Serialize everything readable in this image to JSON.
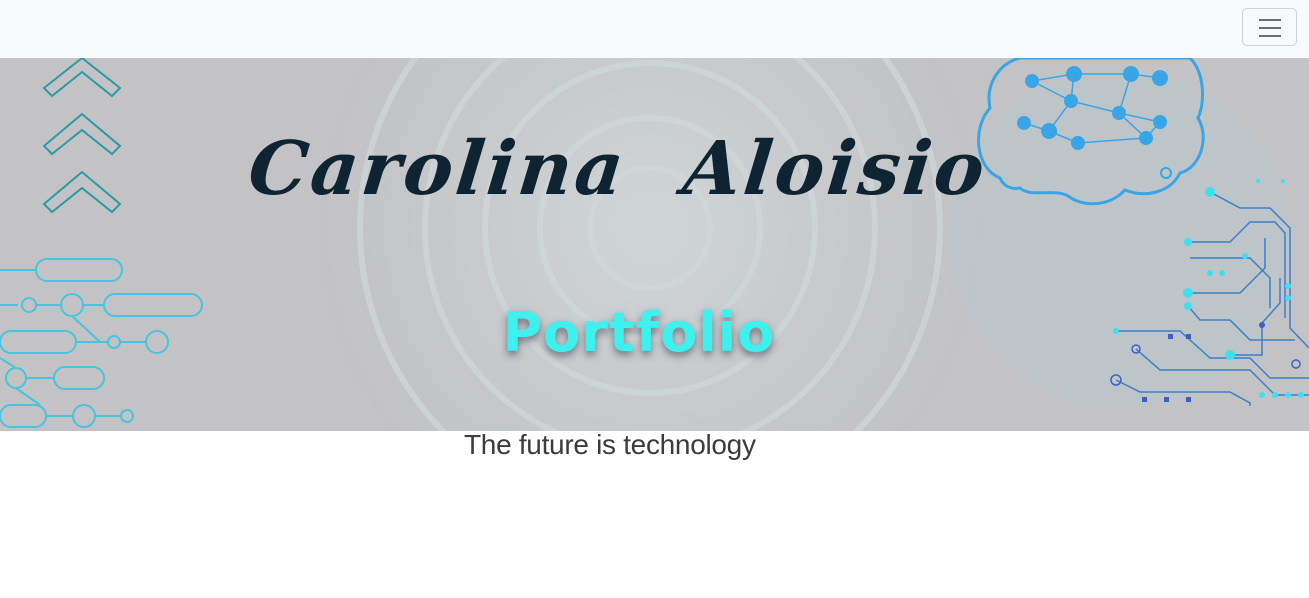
{
  "navbar": {
    "toggle_icon": "hamburger-menu-icon",
    "background": "#f8f9fa"
  },
  "hero": {
    "name": "Carolina  Aloisio",
    "subtitle": "Portfolio",
    "name_color": "#0f2432",
    "subtitle_color": "#3ef0ee",
    "decor_icons": [
      "chevron-up-stack-icon",
      "circuit-lines-icon",
      "brain-network-icon",
      "circuit-board-icon"
    ]
  },
  "tagline": "The future is technology"
}
